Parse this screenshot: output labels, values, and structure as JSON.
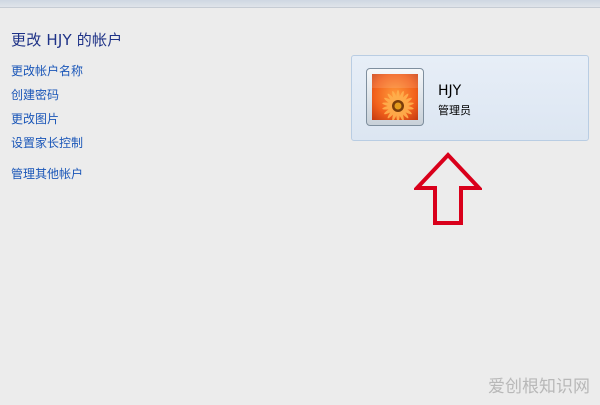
{
  "page": {
    "title": "更改 HJY 的帐户"
  },
  "tasks": [
    "更改帐户名称",
    "创建密码",
    "更改图片",
    "设置家长控制",
    "管理其他帐户"
  ],
  "account": {
    "name": "HJY",
    "role": "管理员",
    "avatar_icon": "orange-flower-icon"
  },
  "annotation": {
    "arrow_icon": "red-up-arrow-icon",
    "arrow_color": "#d9001b"
  },
  "watermark": "爱创根知识网",
  "colors": {
    "title": "#1e3287",
    "link": "#1a56b8",
    "background": "#ececec",
    "card_border": "#b9cde3"
  }
}
